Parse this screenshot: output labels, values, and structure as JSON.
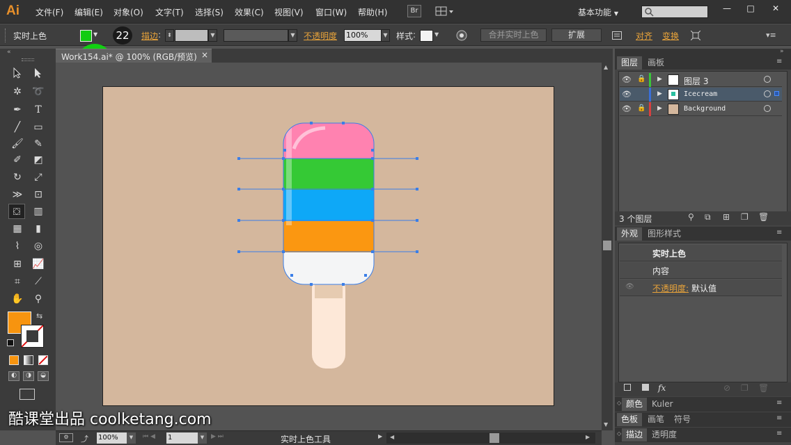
{
  "app": {
    "logo": "Ai",
    "menu": [
      "文件(F)",
      "编辑(E)",
      "对象(O)",
      "文字(T)",
      "选择(S)",
      "效果(C)",
      "视图(V)",
      "窗口(W)",
      "帮助(H)"
    ],
    "bridge_button": "Br",
    "workspace": "基本功能",
    "window_buttons": [
      "—",
      "□",
      "✕"
    ]
  },
  "control_bar": {
    "tool_name": "实时上色",
    "stroke_label": "描边",
    "stroke_weight": "22",
    "opacity_label": "不透明度",
    "opacity_value": "100%",
    "style_label": "样式",
    "merge_button": "合并实时上色",
    "expand_button": "扩展",
    "align_label": "对齐",
    "transform_label": "变换",
    "fill_color": "#11cc11"
  },
  "document": {
    "tab_title": "Work154.ai* @ 100% (RGB/预览)",
    "close": "×"
  },
  "status_bar": {
    "zoom": "100%",
    "page": "1",
    "current_tool": "实时上色工具"
  },
  "layers_panel": {
    "tabs": [
      "图层",
      "画板"
    ],
    "layers": [
      {
        "name": "图层 3",
        "color": "#3ac63a",
        "selected": false
      },
      {
        "name": "Icecream",
        "color": "#3a6fd8",
        "selected": true
      },
      {
        "name": "Background",
        "color": "#d84040",
        "selected": false
      }
    ],
    "count": "3 个图层"
  },
  "appearance_panel": {
    "tabs": [
      "外观",
      "图形样式"
    ],
    "title": "实时上色",
    "content": "内容",
    "opacity_label": "不透明度:",
    "opacity_value": "默认值",
    "fx": "fx"
  },
  "collapsed_panels": [
    {
      "tabs": [
        "颜色",
        "Kuler"
      ]
    },
    {
      "tabs": [
        "色板",
        "画笔",
        "符号"
      ]
    },
    {
      "tabs": [
        "描边",
        "透明度"
      ]
    }
  ],
  "toolbox": {
    "fill_color": "#f7940f",
    "stroke_color": "none"
  },
  "artwork": {
    "artboard_color": "#d4b79d",
    "bands": [
      "#ff82b0",
      "#35c935",
      "#0ea8f7",
      "#fb9711",
      "#f4f5f6"
    ],
    "stick_color": "#fde8d8"
  },
  "watermark": "酷课堂出品 coolketang.com"
}
